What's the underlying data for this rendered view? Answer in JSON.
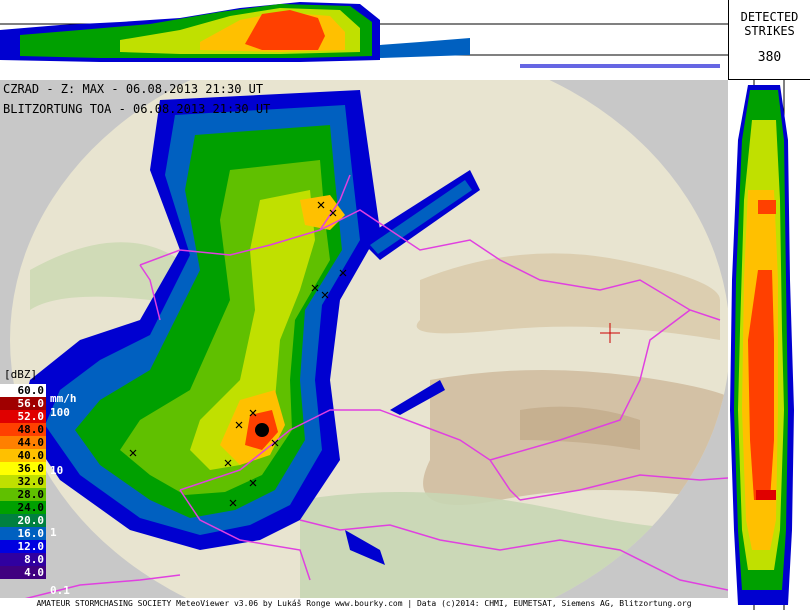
{
  "header": {
    "line1": "CZRAD - Z: MAX - 06.08.2013 21:30 UT",
    "line2": "BLITZORTUNG TOA - 06.08.2013 21:30 UT"
  },
  "strikes": {
    "label": "DETECTED\nSTRIKES",
    "count": "380"
  },
  "legend": {
    "unit": "[dBZ]",
    "rate_unit": "mm/h",
    "levels": [
      {
        "dbz": "60.0",
        "bg": "#ffffff",
        "fg": "#000000"
      },
      {
        "dbz": "56.0",
        "bg": "#a00000",
        "fg": "#ffffff"
      },
      {
        "dbz": "52.0",
        "bg": "#e00000",
        "fg": "#ffffff"
      },
      {
        "dbz": "48.0",
        "bg": "#ff4000",
        "fg": "#000000"
      },
      {
        "dbz": "44.0",
        "bg": "#ff8000",
        "fg": "#000000"
      },
      {
        "dbz": "40.0",
        "bg": "#ffc000",
        "fg": "#000000"
      },
      {
        "dbz": "36.0",
        "bg": "#ffff00",
        "fg": "#000000"
      },
      {
        "dbz": "32.0",
        "bg": "#c0e000",
        "fg": "#000000"
      },
      {
        "dbz": "28.0",
        "bg": "#60c000",
        "fg": "#000000"
      },
      {
        "dbz": "24.0",
        "bg": "#00a000",
        "fg": "#000000"
      },
      {
        "dbz": "20.0",
        "bg": "#008040",
        "fg": "#ffffff"
      },
      {
        "dbz": "16.0",
        "bg": "#0060c0",
        "fg": "#ffffff"
      },
      {
        "dbz": "12.0",
        "bg": "#0000e0",
        "fg": "#ffffff"
      },
      {
        "dbz": "8.0",
        "bg": "#3000a0",
        "fg": "#ffffff"
      },
      {
        "dbz": "4.0",
        "bg": "#400080",
        "fg": "#ffffff"
      }
    ],
    "rates": [
      "100",
      "10",
      "1",
      "0.1"
    ]
  },
  "footer": {
    "text": "AMATEUR STORMCHASING SOCIETY MeteoViewer v3.06 by Lukáš Ronge www.bourky.com | Data (c)2014: CHMI, EUMETSAT, Siemens AG, Blitzortung.org"
  },
  "colors": {
    "border": "#e040e0",
    "terrain": "#e8e4d0",
    "outside": "#c8c8c8"
  }
}
